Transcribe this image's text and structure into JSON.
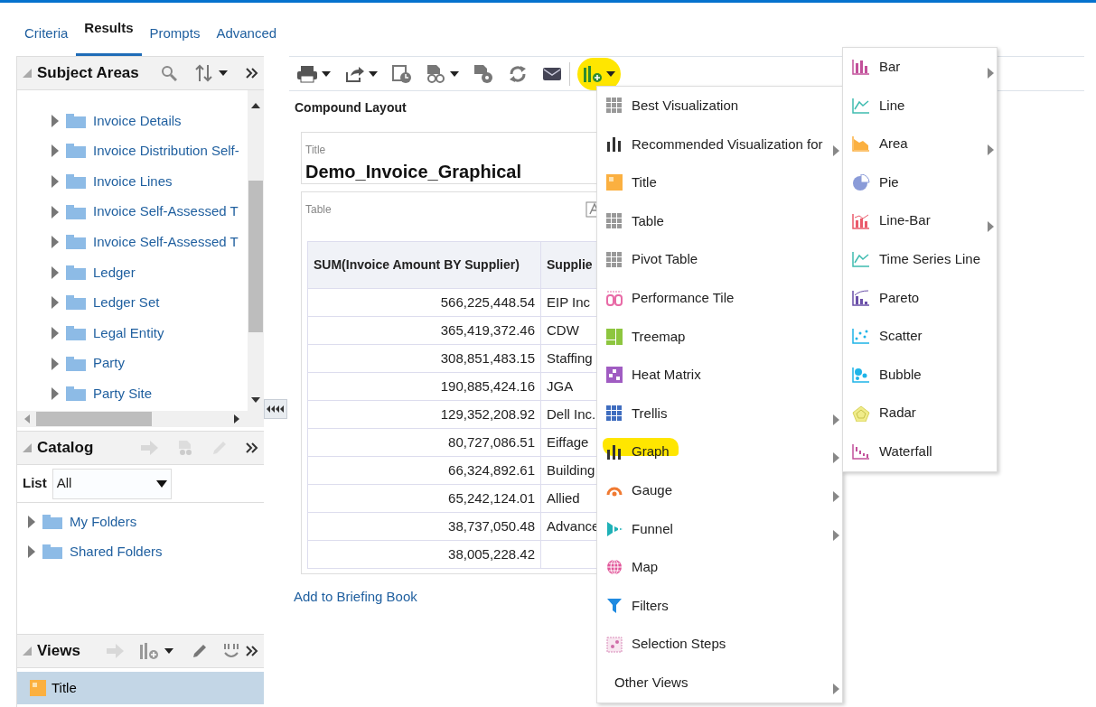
{
  "tabs": [
    {
      "label": "Criteria",
      "selected": false
    },
    {
      "label": "Results",
      "selected": true
    },
    {
      "label": "Prompts",
      "selected": false
    },
    {
      "label": "Advanced",
      "selected": false
    }
  ],
  "subject_areas": {
    "title": "Subject Areas",
    "items": [
      {
        "label": "Invoice Details"
      },
      {
        "label": "Invoice Distribution Self-"
      },
      {
        "label": "Invoice Lines"
      },
      {
        "label": "Invoice Self-Assessed T"
      },
      {
        "label": "Invoice Self-Assessed T"
      },
      {
        "label": "Ledger"
      },
      {
        "label": "Ledger Set"
      },
      {
        "label": "Legal Entity"
      },
      {
        "label": "Party"
      },
      {
        "label": "Party Site"
      }
    ]
  },
  "catalog": {
    "title": "Catalog",
    "list_label": "List",
    "list_value": "All",
    "items": [
      {
        "label": "My Folders"
      },
      {
        "label": "Shared Folders"
      }
    ]
  },
  "views": {
    "title": "Views",
    "items": [
      {
        "label": "Title",
        "selected": true
      }
    ]
  },
  "main": {
    "section_title": "Compound Layout",
    "title_view": {
      "caption": "Title",
      "text": "Demo_Invoice_Graphical"
    },
    "table_view": {
      "caption": "Table",
      "columns": [
        "SUM(Invoice Amount BY Supplier)",
        "Supplie"
      ],
      "rows": [
        [
          "566,225,448.54",
          "EIP Inc"
        ],
        [
          "365,419,372.46",
          "CDW"
        ],
        [
          "308,851,483.15",
          "Staffing"
        ],
        [
          "190,885,424.16",
          "JGA"
        ],
        [
          "129,352,208.92",
          "Dell Inc."
        ],
        [
          "80,727,086.51",
          "Eiffage"
        ],
        [
          "66,324,892.61",
          "Building"
        ],
        [
          "65,242,124.01",
          "Allied"
        ],
        [
          "38,737,050.48",
          "Advance"
        ],
        [
          "38,005,228.42",
          ""
        ]
      ]
    },
    "link": "Add to Briefing Book"
  },
  "view_menu": {
    "button_highlighted": true,
    "items": [
      {
        "label": "Best Visualization",
        "submenu": false,
        "highlighted": false
      },
      {
        "label": "Recommended Visualization for",
        "submenu": true,
        "highlighted": false
      },
      {
        "label": "Title",
        "submenu": false,
        "highlighted": false
      },
      {
        "label": "Table",
        "submenu": false,
        "highlighted": false
      },
      {
        "label": "Pivot Table",
        "submenu": false,
        "highlighted": false
      },
      {
        "label": "Performance Tile",
        "submenu": false,
        "highlighted": false
      },
      {
        "label": "Treemap",
        "submenu": false,
        "highlighted": false
      },
      {
        "label": "Heat Matrix",
        "submenu": false,
        "highlighted": false
      },
      {
        "label": "Trellis",
        "submenu": true,
        "highlighted": false
      },
      {
        "label": "Graph",
        "submenu": true,
        "highlighted": true
      },
      {
        "label": "Gauge",
        "submenu": true,
        "highlighted": false
      },
      {
        "label": "Funnel",
        "submenu": true,
        "highlighted": false
      },
      {
        "label": "Map",
        "submenu": false,
        "highlighted": false
      },
      {
        "label": "Filters",
        "submenu": false,
        "highlighted": false
      },
      {
        "label": "Selection Steps",
        "submenu": false,
        "highlighted": false
      },
      {
        "label": "Other Views",
        "submenu": true,
        "highlighted": false
      }
    ]
  },
  "graph_menu": {
    "items": [
      {
        "label": "Bar",
        "submenu": true
      },
      {
        "label": "Line",
        "submenu": false
      },
      {
        "label": "Area",
        "submenu": true
      },
      {
        "label": "Pie",
        "submenu": false
      },
      {
        "label": "Line-Bar",
        "submenu": true
      },
      {
        "label": "Time Series Line",
        "submenu": false
      },
      {
        "label": "Pareto",
        "submenu": false
      },
      {
        "label": "Scatter",
        "submenu": false
      },
      {
        "label": "Bubble",
        "submenu": false
      },
      {
        "label": "Radar",
        "submenu": false
      },
      {
        "label": "Waterfall",
        "submenu": false
      }
    ]
  }
}
